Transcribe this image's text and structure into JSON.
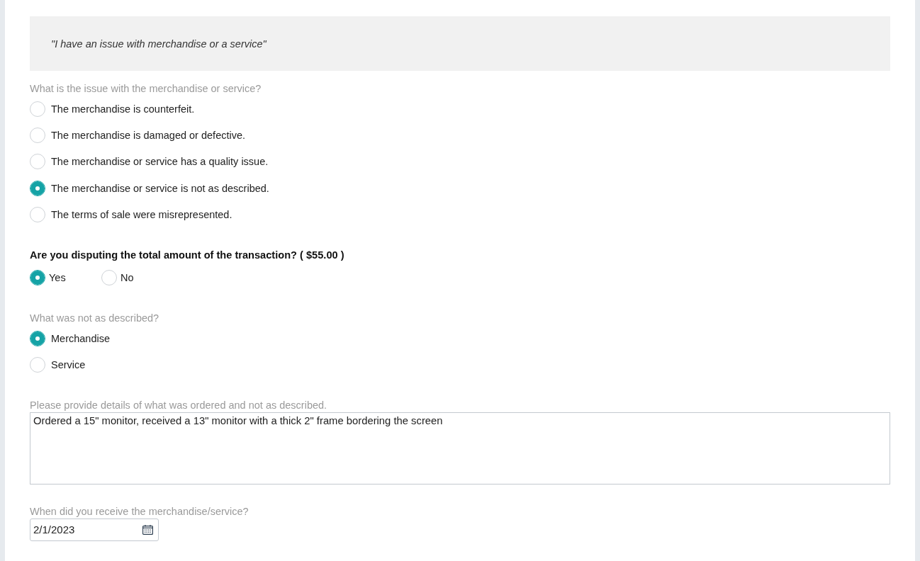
{
  "banner": {
    "text": "\"I have an issue with merchandise or a service\""
  },
  "questions": [
    {
      "kind": "radio_list",
      "label": "What is the issue with the merchandise or service?",
      "options": [
        {
          "label": "The merchandise is counterfeit.",
          "selected": false
        },
        {
          "label": "The merchandise is damaged or defective.",
          "selected": false
        },
        {
          "label": "The merchandise or service has a quality issue.",
          "selected": false
        },
        {
          "label": "The merchandise or service is not as described.",
          "selected": true
        },
        {
          "label": "The terms of sale were misrepresented.",
          "selected": false
        }
      ]
    },
    {
      "kind": "inline_radio",
      "label": "Are you disputing the total amount of the transaction? ( $55.00 )",
      "options": [
        {
          "label": "Yes",
          "selected": true
        },
        {
          "label": "No",
          "selected": false
        }
      ]
    },
    {
      "kind": "radio_list",
      "label": "What was not as described?",
      "options": [
        {
          "label": "Merchandise",
          "selected": true
        },
        {
          "label": "Service",
          "selected": false
        }
      ]
    },
    {
      "kind": "textarea",
      "label": "Please provide details of what was ordered and not as described.",
      "value": "Ordered a 15\" monitor, received a 13\" monitor with a thick 2\" frame bordering the screen"
    },
    {
      "kind": "date",
      "label": "When did you receive the merchandise/service?",
      "value": "2/1/2023"
    }
  ]
}
